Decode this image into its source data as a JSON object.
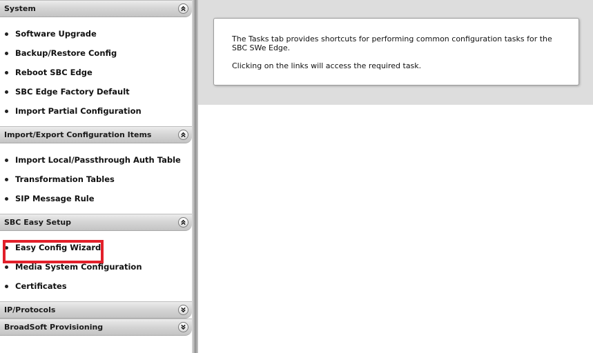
{
  "sidebar": {
    "sections": [
      {
        "title": "System",
        "expanded": true,
        "items": [
          "Software Upgrade",
          "Backup/Restore Config",
          "Reboot SBC Edge",
          "SBC Edge Factory Default",
          "Import Partial Configuration"
        ]
      },
      {
        "title": "Import/Export Configuration Items",
        "expanded": true,
        "items": [
          "Import Local/Passthrough Auth Table",
          "Transformation Tables",
          "SIP Message Rule"
        ]
      },
      {
        "title": "SBC Easy Setup",
        "expanded": true,
        "items": [
          "Easy Config Wizard",
          "Media System Configuration",
          "Certificates"
        ]
      },
      {
        "title": "IP/Protocols",
        "expanded": false,
        "items": []
      },
      {
        "title": "BroadSoft Provisioning",
        "expanded": false,
        "items": []
      }
    ]
  },
  "main": {
    "info_line1": "The Tasks tab provides shortcuts for performing common configuration tasks for the SBC SWe Edge.",
    "info_line2": "Clicking on the links will access the required task."
  },
  "colors": {
    "highlight": "#e2202a",
    "main_background": "#dddddd"
  },
  "icons": {
    "expanded": "double-chevron-up-icon",
    "collapsed": "double-chevron-down-icon"
  }
}
